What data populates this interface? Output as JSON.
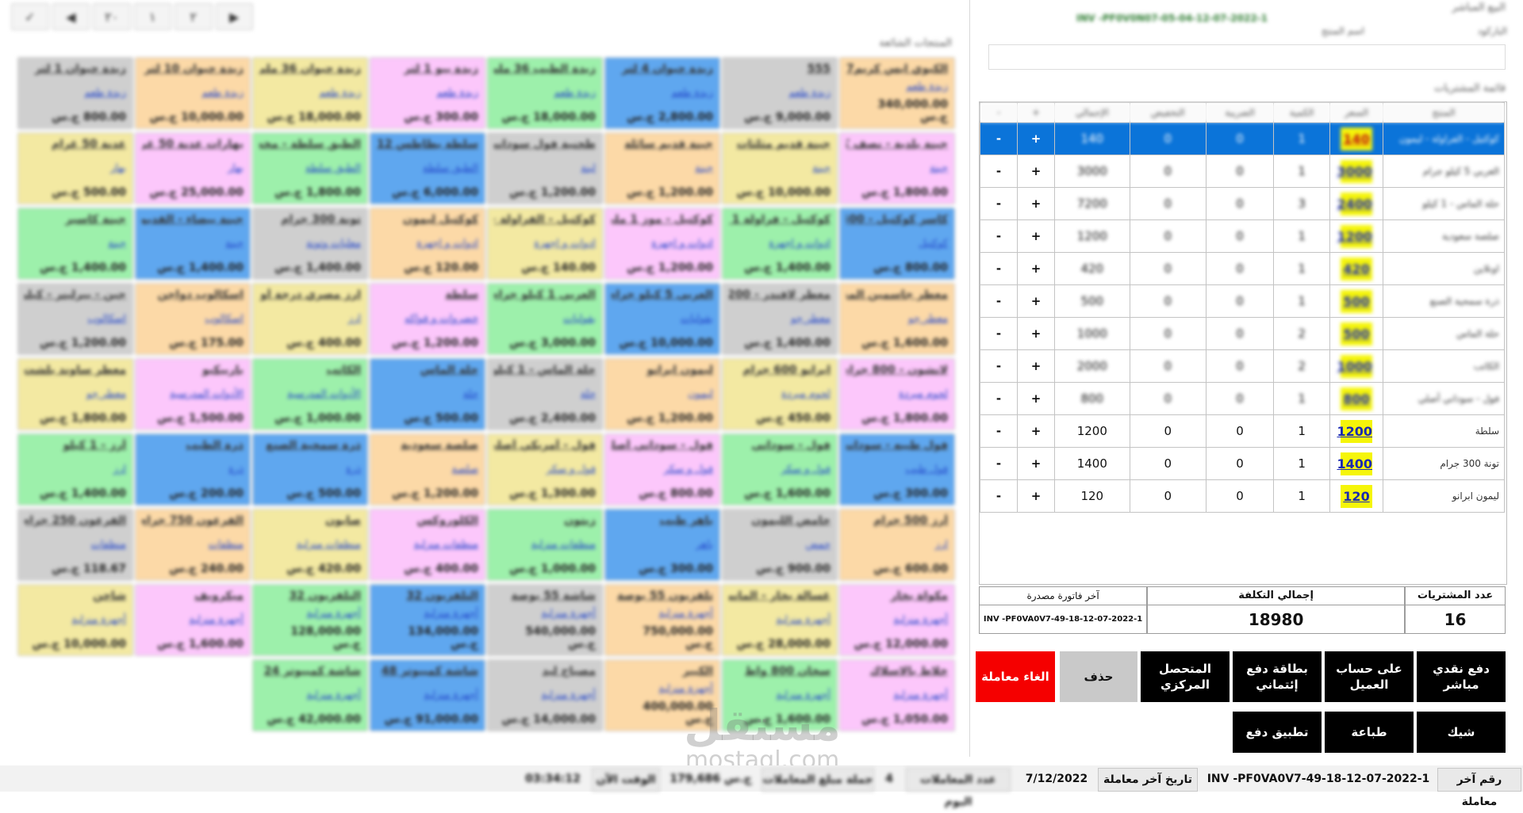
{
  "toolbar": {
    "buttons": [
      "✓",
      "◀",
      "۲۰",
      "۱",
      "۲",
      "▶"
    ]
  },
  "grid_title": "المنتجات الشائعة",
  "products": [
    {
      "name": "الكيوي ايس كريم7",
      "category": "زبدة طعم",
      "price": "340,000.00 ج.س",
      "color": "c-orange"
    },
    {
      "name": "555",
      "category": "زبدة طعم",
      "price": "9,000.00 ج.س",
      "color": "c-gray"
    },
    {
      "name": "زبدة حيوان 4 لتر",
      "category": "زبدة طعم",
      "price": "2,800.00 ج.س",
      "color": "c-blue"
    },
    {
      "name": "زبدة الطيب 36 ملي",
      "category": "زبدة طعم",
      "price": "18,000.00 ج.س",
      "color": "c-green"
    },
    {
      "name": "زبدة بيو 1 لتر",
      "category": "زبدة طعم",
      "price": "300.00 ج.س",
      "color": "c-pink"
    },
    {
      "name": "زبدة حيوان 36 ملي",
      "category": "زبدة طعم",
      "price": "18,000.00 ج.س",
      "color": "c-yellow"
    },
    {
      "name": "زبدة حيوان 10 لتر",
      "category": "زبدة طعم",
      "price": "10,000.00 ج.س",
      "color": "c-orange"
    },
    {
      "name": "زبدة حيوان 1 لتر",
      "category": "زبدة طعم",
      "price": "800.00 ج.س",
      "color": "c-gray"
    },
    {
      "name": "جبنة بلدية - نصف كيلو",
      "category": "جبنة",
      "price": "1,800.00 ج.س",
      "color": "c-pink"
    },
    {
      "name": "جبنة قديم مثلثات",
      "category": "جبنة",
      "price": "10,000.00 ج.س",
      "color": "c-yellow"
    },
    {
      "name": "جبنة قديم سائلة",
      "category": "جبنة",
      "price": "1,200.00 ج.س",
      "color": "c-orange"
    },
    {
      "name": "طحنية فول سوداني",
      "category": "لبنة",
      "price": "1,200.00 ج.س",
      "color": "c-gray"
    },
    {
      "name": "سلطة بطاطس 12",
      "category": "الطبق سلطة",
      "price": "6,000.00 ج.س",
      "color": "c-blue"
    },
    {
      "name": "الطبق سلطة - مخصوص 1",
      "category": "الطبق سلطة",
      "price": "1,800.00 ج.س",
      "color": "c-green"
    },
    {
      "name": "بهارات عدنة 50 غرام",
      "category": "بهار",
      "price": "25,000.00 ج.س",
      "color": "c-pink"
    },
    {
      "name": "عدنة 50 غرام",
      "category": "بهار",
      "price": "500.00 ج.س",
      "color": "c-yellow"
    },
    {
      "name": "كاسر كوكتيل - 400",
      "category": "كوكتيل",
      "price": "800.00 ج.س",
      "color": "c-blue"
    },
    {
      "name": "كوكتيل - فراولة 1 ملي",
      "category": "ادوات و اجهزة",
      "price": "1,400.00 ج.س",
      "color": "c-green"
    },
    {
      "name": "كوكتيل - موز 1 ملي",
      "category": "ادوات و اجهزة",
      "price": "1,200.00 ج.س",
      "color": "c-pink"
    },
    {
      "name": "كوكتيل - الفراولة - ليمون",
      "category": "ادوات و اجهزة",
      "price": "140.00 ج.س",
      "color": "c-yellow"
    },
    {
      "name": "كوكتيل ليمون",
      "category": "ادوات و اجهزة",
      "price": "120.00 ج.س",
      "color": "c-orange"
    },
    {
      "name": "تونة 300 جرام",
      "category": "معلبات وتونة",
      "price": "1,400.00 ج.س",
      "color": "c-gray"
    },
    {
      "name": "جبنة بيضاء - القديم",
      "category": "جبنة",
      "price": "1,400.00 ج.س",
      "color": "c-blue"
    },
    {
      "name": "جبنة كاسبر",
      "category": "جبنة",
      "price": "1,400.00 ج.س",
      "color": "c-green"
    },
    {
      "name": "معطر جاسمين المنزل",
      "category": "معطر جو",
      "price": "1,600.00 ج.س",
      "color": "c-orange"
    },
    {
      "name": "معطر لافندر - 200",
      "category": "معطر جو",
      "price": "1,400.00 ج.س",
      "color": "c-gray"
    },
    {
      "name": "العربي 5 كيلو جرام",
      "category": "بقوليات",
      "price": "10,000.00 ج.س",
      "color": "c-blue"
    },
    {
      "name": "العربي 1 كيلو جرام",
      "category": "بقوليات",
      "price": "3,000.00 ج.س",
      "color": "c-green"
    },
    {
      "name": "سلطة",
      "category": "خضروات و فواكه",
      "price": "1,200.00 ج.س",
      "color": "c-pink"
    },
    {
      "name": "ارز مصري درجة أولى",
      "category": "ارز",
      "price": "400.00 ج.س",
      "color": "c-yellow"
    },
    {
      "name": "اسكالوب دواجن",
      "category": "اسكالوب",
      "price": "175.00 ج.س",
      "color": "c-orange"
    },
    {
      "name": "جبن - بيرلينر - كيلو",
      "category": "اسكالوب",
      "price": "1,200.00 ج.س",
      "color": "c-gray"
    },
    {
      "name": "لانشون - 800 جرام",
      "category": "لحوم مبردة",
      "price": "1,800.00 ج.س",
      "color": "c-pink"
    },
    {
      "name": "ابرانو 600 جرام",
      "category": "لحوم مبردة",
      "price": "450.00 ج.س",
      "color": "c-yellow"
    },
    {
      "name": "ليمون ابرانو",
      "category": "ليمون",
      "price": "1,200.00 ج.س",
      "color": "c-orange"
    },
    {
      "name": "حلة الماس - 1 كيلو",
      "category": "حلة",
      "price": "2,400.00 ج.س",
      "color": "c-gray"
    },
    {
      "name": "حلة الماس",
      "category": "حلة",
      "price": "500.00 ج.س",
      "color": "c-blue"
    },
    {
      "name": "الكاتب",
      "category": "الأدوات المدرسية",
      "price": "1,000.00 ج.س",
      "color": "c-green"
    },
    {
      "name": "باربيكيو",
      "category": "الأدوات المدرسية",
      "price": "1,500.00 ج.س",
      "color": "c-pink"
    },
    {
      "name": "معطر ساوند بلشت",
      "category": "معطر جو",
      "price": "1,800.00 ج.س",
      "color": "c-yellow"
    },
    {
      "name": "فول طيبه - سوداني",
      "category": "فول طيب",
      "price": "300.00 ج.س",
      "color": "c-blue"
    },
    {
      "name": "فول - سوداني",
      "category": "فول و سكر",
      "price": "1,600.00 ج.س",
      "color": "c-green"
    },
    {
      "name": "فول - سوداني أصلي",
      "category": "فول و سكر",
      "price": "800.00 ج.س",
      "color": "c-pink"
    },
    {
      "name": "فول - أمريكي أصلي",
      "category": "فول و سكر",
      "price": "1,300.00 ج.س",
      "color": "c-yellow"
    },
    {
      "name": "صلصة سعودية",
      "category": "صلصة",
      "price": "1,200.00 ج.س",
      "color": "c-orange"
    },
    {
      "name": "ذرة سمحية الصنع",
      "category": "ذرة",
      "price": "500.00 ج.س",
      "color": "c-blue"
    },
    {
      "name": "ذرة الطيب",
      "category": "ذرة",
      "price": "200.00 ج.س",
      "color": "c-blue"
    },
    {
      "name": "أرز - 1 كيلو",
      "category": "ارز",
      "price": "1,400.00 ج.س",
      "color": "c-green"
    },
    {
      "name": "أرز 500 جرام",
      "category": "ارز",
      "price": "600.00 ج.س",
      "color": "c-orange"
    },
    {
      "name": "حامض الليمون",
      "category": "حمض",
      "price": "900.00 ج.س",
      "color": "c-gray"
    },
    {
      "name": "باهر طيب",
      "category": "باهر",
      "price": "300.00 ج.س",
      "color": "c-blue"
    },
    {
      "name": "زيتون",
      "category": "منظفات منزلية",
      "price": "1,000.00 ج.س",
      "color": "c-green"
    },
    {
      "name": "الكلوروكس",
      "category": "منظفات منزلية",
      "price": "400.00 ج.س",
      "color": "c-pink"
    },
    {
      "name": "صابون",
      "category": "منظفات منزلية",
      "price": "420.00 ج.س",
      "color": "c-yellow"
    },
    {
      "name": "الفرعون 750 جرام",
      "category": "منظفات",
      "price": "240.00 ج.س",
      "color": "c-orange"
    },
    {
      "name": "الفرعون 250 جرام",
      "category": "منظفات",
      "price": "118.67 ج.س",
      "color": "c-gray"
    },
    {
      "name": "مكواة بخار",
      "category": "أجهزة منزلية",
      "price": "12,000.00 ج.س",
      "color": "c-pink"
    },
    {
      "name": "غسالة بخار - الماني",
      "category": "أجهزة منزلية",
      "price": "28,000.00 ج.س",
      "color": "c-yellow"
    },
    {
      "name": "تلفزيون 55 بوصة",
      "category": "أجهزة منزلية",
      "price": "750,000.00 ج.س",
      "color": "c-orange"
    },
    {
      "name": "شاشة 55 بوصة",
      "category": "أجهزة منزلية",
      "price": "540,000.00 ج.س",
      "color": "c-gray"
    },
    {
      "name": "التلفزيون 32",
      "category": "أجهزة منزلية",
      "price": "134,000.00 ج.س",
      "color": "c-blue"
    },
    {
      "name": "التلفزيون 32",
      "category": "أجهزة منزلية",
      "price": "128,000.00 ج.س",
      "color": "c-green"
    },
    {
      "name": "ميكرويف",
      "category": "أجهزة منزلية",
      "price": "1,600.00 ج.س",
      "color": "c-pink"
    },
    {
      "name": "شاحن",
      "category": "أجهزة منزلية",
      "price": "10,000.00 ج.س",
      "color": "c-yellow"
    },
    {
      "name": "خلاط بالاسلاك",
      "category": "أجهزة منزلية",
      "price": "1,050.00 ج.س",
      "color": "c-pink"
    },
    {
      "name": "سخان 800 واط",
      "category": "أجهزة منزلية",
      "price": "1,600.00 ج.س",
      "color": "c-green"
    },
    {
      "name": "الكبير",
      "category": "أجهزة منزلية",
      "price": "400,000.00 ج.س",
      "color": "c-orange"
    },
    {
      "name": "مصباح ليد",
      "category": "أجهزة منزلية",
      "price": "14,000.00 ج.س",
      "color": "c-gray"
    },
    {
      "name": "شاشة كمبيوتر 48",
      "category": "أجهزة منزلية",
      "price": "91,000.00 ج.س",
      "color": "c-blue"
    },
    {
      "name": "شاشة كمبيوتر 24",
      "category": "أجهزة منزلية",
      "price": "42,000.00 ج.س",
      "color": "c-green"
    }
  ],
  "sale": {
    "title": "البيع المباشر",
    "invoice_header": "INV -PF0V0N07-05-04-12-07-2022-1",
    "barcode_label": "الباركود",
    "product_name_label": "اسم المنتج",
    "items_title": "قائمة المشتريات"
  },
  "items_table": {
    "headers": [
      "المنتج",
      "السعر",
      "الكمية",
      "الضريبة",
      "التخفيض",
      "الإجمالي",
      "+",
      "-"
    ],
    "rows": [
      {
        "name": "كوكتيل - الفراولة - ليمون",
        "price": "140",
        "qty": "1",
        "tax": "0",
        "disc": "0",
        "total": "140",
        "selected": true
      },
      {
        "name": "العربي 5 كيلو جرام",
        "price": "3000",
        "qty": "1",
        "tax": "0",
        "disc": "0",
        "total": "3000"
      },
      {
        "name": "حلة الماس - 1 كيلو",
        "price": "2400",
        "qty": "3",
        "tax": "0",
        "disc": "0",
        "total": "7200"
      },
      {
        "name": "صلصة سعودية",
        "price": "1200",
        "qty": "1",
        "tax": "0",
        "disc": "0",
        "total": "1200"
      },
      {
        "name": "اونلاين",
        "price": "420",
        "qty": "1",
        "tax": "0",
        "disc": "0",
        "total": "420"
      },
      {
        "name": "ذرة سمحية الصنع",
        "price": "500",
        "qty": "1",
        "tax": "0",
        "disc": "0",
        "total": "500"
      },
      {
        "name": "حلة الماس",
        "price": "500",
        "qty": "2",
        "tax": "0",
        "disc": "0",
        "total": "1000"
      },
      {
        "name": "الكاتب",
        "price": "1000",
        "qty": "2",
        "tax": "0",
        "disc": "0",
        "total": "2000"
      },
      {
        "name": "فول - سوداني أصلي",
        "price": "800",
        "qty": "1",
        "tax": "0",
        "disc": "0",
        "total": "800"
      },
      {
        "name": "سلطة",
        "price": "1200",
        "qty": "1",
        "tax": "0",
        "disc": "0",
        "total": "1200"
      },
      {
        "name": "تونة 300 جرام",
        "price": "1400",
        "qty": "1",
        "tax": "0",
        "disc": "0",
        "total": "1400"
      },
      {
        "name": "ليمون ابرانو",
        "price": "120",
        "qty": "1",
        "tax": "0",
        "disc": "0",
        "total": "120"
      }
    ],
    "plus": "+",
    "minus": "-"
  },
  "summary": {
    "count_label": "عدد المشتريات",
    "count_value": "16",
    "total_label": "إجمالي التكلفة",
    "total_value": "18980",
    "last_invoice_label": "آخر فاتورة مصدرة",
    "last_invoice_value": "INV -PF0VA0V7-49-18-12-07-2022-1"
  },
  "actions": {
    "cash": "دفع نقدي مباشر",
    "account": "على حساب العميل",
    "card": "بطاقة دفع إئتماني",
    "central": "المتحصل المركزي",
    "delete": "حذف",
    "cancel": "الغاء معاملة",
    "cheque": "شيك",
    "print": "طباعة",
    "app": "تطبيق دفع"
  },
  "colors": {
    "selected_row": "#0b74d9",
    "cancel": "#f50000",
    "price_highlight": "#f5f50a"
  },
  "status": {
    "last_tx_label": "رقم آخر معاملة",
    "last_tx_value": "INV -PF0VA0V7-49-18-12-07-2022-1",
    "last_date_label": "تاريخ آخر معاملة",
    "last_date_value": "7/12/2022",
    "today_count_label": "عدد المعاملات اليوم",
    "today_count_value": "4",
    "total_label": "جملة مبلغ المعاملات",
    "total_value": "179,686 ج.س",
    "time_label": "الوقت الآن",
    "time_value": "03:34:12"
  },
  "watermark": {
    "arabic": "مستقل",
    "latin": "mostaql.com"
  }
}
